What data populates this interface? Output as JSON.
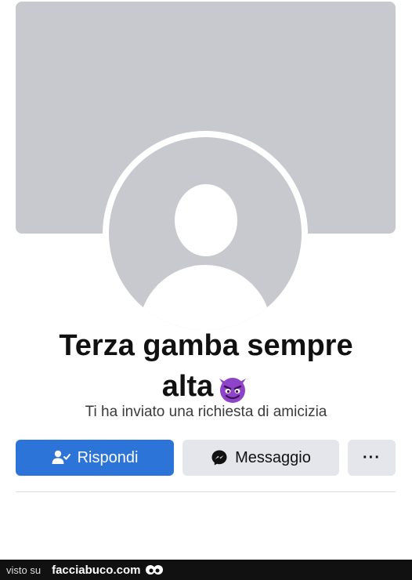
{
  "profile": {
    "name_line1": "Terza gamba sempre",
    "name_line2": "alta",
    "name_emoji": "devil-emoji",
    "subtitle": "Ti ha inviato una richiesta di amicizia"
  },
  "actions": {
    "respond_label": "Rispondi",
    "message_label": "Messaggio",
    "more_label": "···"
  },
  "footer": {
    "seen_on": "visto su",
    "site": "facciabuco.com"
  },
  "colors": {
    "primary_button": "#2d74d9",
    "secondary_button": "#e4e6eb",
    "placeholder_gray": "#c8c9ce",
    "emoji_purple": "#8e44c9"
  },
  "icons": {
    "respond": "person-check-icon",
    "message": "messenger-icon",
    "more": "more-dots-icon"
  }
}
